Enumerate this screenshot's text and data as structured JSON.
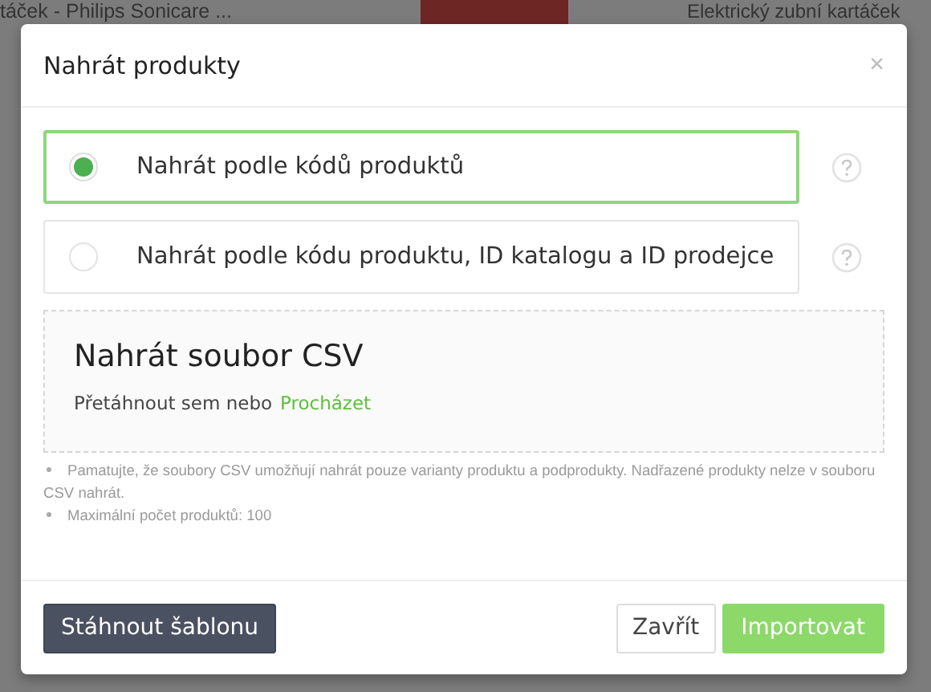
{
  "background": {
    "texts": [
      "táček - Philips Sonicare ...",
      "Elektrický zubní kartáček"
    ]
  },
  "modal": {
    "title": "Nahrát produkty",
    "close": "×",
    "options": [
      {
        "label": "Nahrát podle kódů produktů",
        "selected": true
      },
      {
        "label": "Nahrát podle kódu produktu, ID katalogu a ID prodejce",
        "selected": false
      }
    ],
    "dropzone": {
      "title": "Nahrát soubor CSV",
      "hint": "Přetáhnout sem nebo",
      "link": "Procházet"
    },
    "notes": [
      "Pamatujte, že soubory CSV umožňují nahrát pouze varianty produktu a podprodukty. Nadřazené produkty nelze v souboru CSV nahrát.",
      "Maximální počet produktů: 100"
    ],
    "footer": {
      "download": "Stáhnout šablonu",
      "close": "Zavřít",
      "import": "Importovat"
    }
  }
}
